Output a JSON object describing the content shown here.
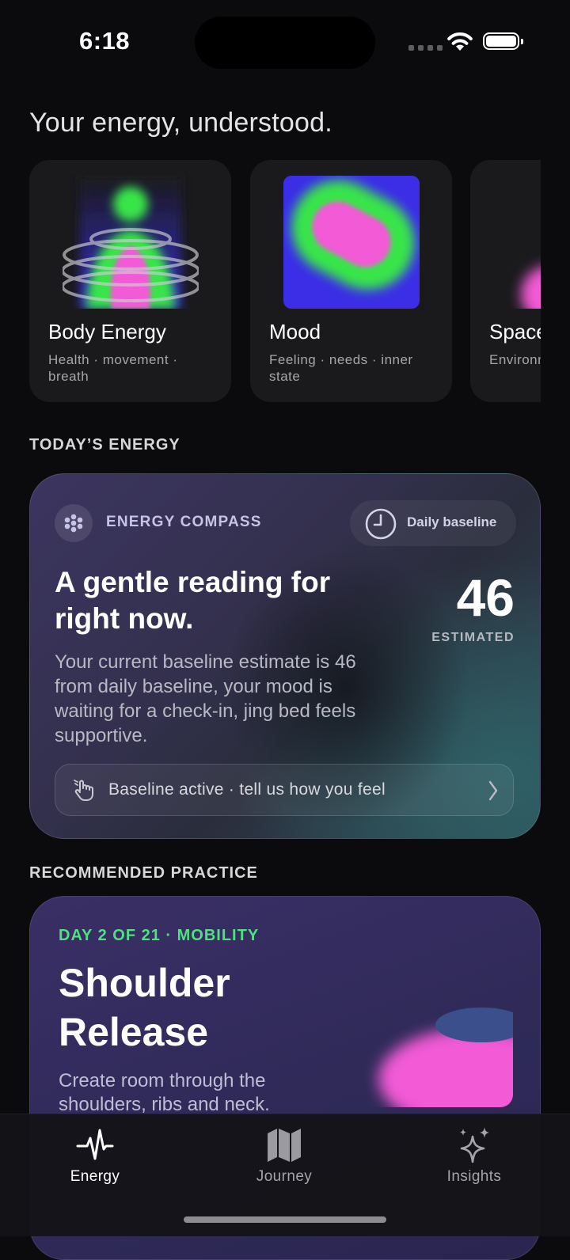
{
  "status_bar": {
    "time": "6:18"
  },
  "headline": "Your energy, understood.",
  "dimensions": [
    {
      "title": "Body Energy",
      "subtitle": "Health · movement · breath"
    },
    {
      "title": "Mood",
      "subtitle": "Feeling · needs · inner state"
    },
    {
      "title": "Space",
      "subtitle": "Environment"
    }
  ],
  "todays_energy": {
    "section_label": "TODAY’S ENERGY",
    "card_label": "ENERGY COMPASS",
    "source_pill": "Daily baseline",
    "title": "A gentle reading for right now.",
    "score": "46",
    "score_label": "ESTIMATED",
    "description": "Your current baseline estimate is 46 from daily baseline, your mood is waiting for a check-in, jing bed feels supportive.",
    "cta_label": "Baseline active · tell us how you feel"
  },
  "recommended": {
    "section_label": "RECOMMENDED PRACTICE",
    "day_label": "DAY 2 OF 21 · MOBILITY",
    "title": "Shoulder Release",
    "description": "Create room through the shoulders, ribs and neck."
  },
  "tabs": [
    {
      "label": "Energy",
      "icon": "pulse-icon",
      "active": true
    },
    {
      "label": "Journey",
      "icon": "map-icon",
      "active": false
    },
    {
      "label": "Insights",
      "icon": "sparkles-icon",
      "active": false
    }
  ],
  "colors": {
    "accent_green": "#4fe07f",
    "magenta": "#f25ad6",
    "background": "#0b0b0d"
  }
}
